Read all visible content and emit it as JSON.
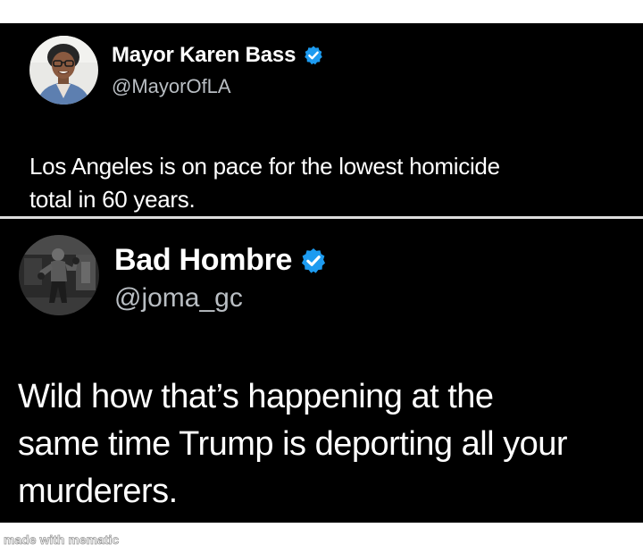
{
  "tweets": [
    {
      "display_name": "Mayor Karen Bass",
      "handle": "@MayorOfLA",
      "verified": true,
      "avatar": "profile-photo-woman-icon",
      "text_lines": [
        "Los Angeles is on pace for the lowest homicide",
        "total in 60 years."
      ]
    },
    {
      "display_name": "Bad Hombre",
      "handle": "@joma_gc",
      "verified": true,
      "avatar": "profile-photo-boxer-icon",
      "text_lines": [
        "Wild how that’s happening at the",
        "same time Trump is deporting all your",
        "murderers."
      ]
    }
  ],
  "watermark": "made with mematic",
  "colors": {
    "background": "#000000",
    "text": "#ffffff",
    "handle": "#b9bec3",
    "verified_badge": "#1d9bf0",
    "divider": "#dcdcdc",
    "page": "#ffffff"
  }
}
